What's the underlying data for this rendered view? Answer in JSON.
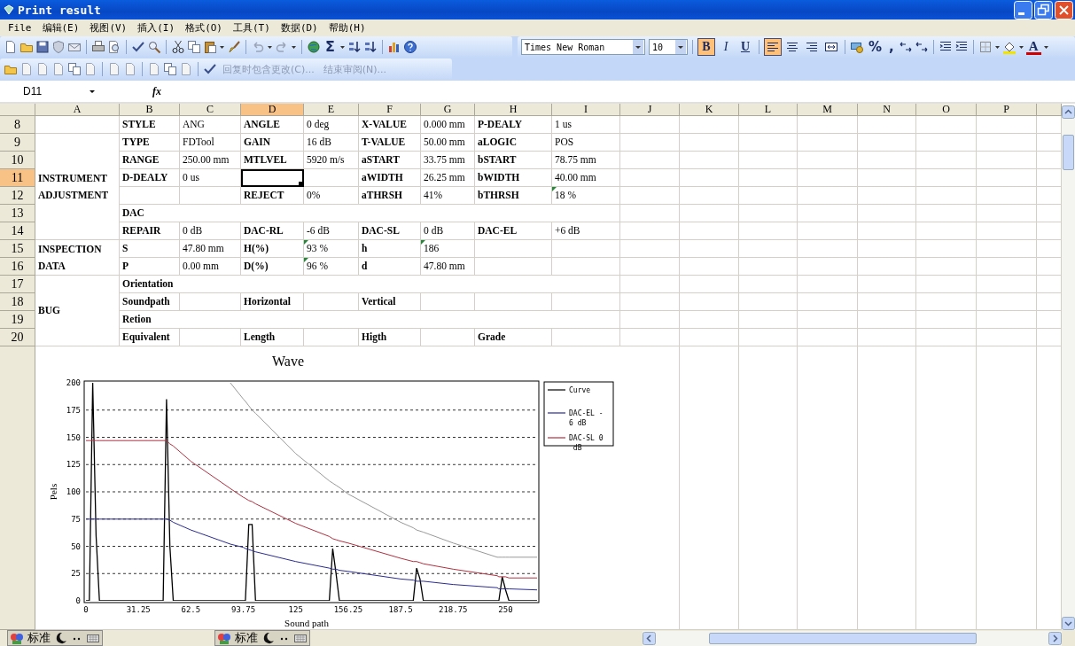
{
  "window": {
    "title": "Print result"
  },
  "menu": [
    {
      "label": "File"
    },
    {
      "label": "编辑(E)"
    },
    {
      "label": "视图(V)"
    },
    {
      "label": "插入(I)"
    },
    {
      "label": "格式(O)"
    },
    {
      "label": "工具(T)"
    },
    {
      "label": "数据(D)"
    },
    {
      "label": "帮助(H)"
    }
  ],
  "standard_toolbar": {
    "autosum_label": "Σ"
  },
  "format_toolbar": {
    "font": "Times New Roman",
    "size": "10",
    "style_buttons": [
      {
        "label": "B",
        "kind": "bold",
        "pressed": true
      },
      {
        "label": "I",
        "kind": "italic",
        "pressed": false
      },
      {
        "label": "U",
        "kind": "underline",
        "pressed": false
      }
    ],
    "align_buttons": [
      {
        "kind": "left",
        "pressed": true
      },
      {
        "kind": "center",
        "pressed": false
      },
      {
        "kind": "right",
        "pressed": false
      },
      {
        "kind": "merge",
        "pressed": false
      }
    ],
    "percent_label": "%",
    "comma_label": ",",
    "font_color_label": "A"
  },
  "reviewing_toolbar": {
    "items": [
      {
        "label": "回复时包含更改(C)...",
        "disabled": true
      },
      {
        "label": "结束审阅(N)...",
        "disabled": true
      }
    ]
  },
  "formula_bar": {
    "name_box": "D11",
    "fx_label": "fx"
  },
  "columns": [
    {
      "label": "A",
      "selected": false
    },
    {
      "label": "B",
      "selected": false
    },
    {
      "label": "C",
      "selected": false
    },
    {
      "label": "D",
      "selected": true
    },
    {
      "label": "E",
      "selected": false
    },
    {
      "label": "F",
      "selected": false
    },
    {
      "label": "G",
      "selected": false
    },
    {
      "label": "H",
      "selected": false
    },
    {
      "label": "I",
      "selected": false
    },
    {
      "label": "J",
      "selected": false
    },
    {
      "label": "K",
      "selected": false
    },
    {
      "label": "L",
      "selected": false
    },
    {
      "label": "M",
      "selected": false
    },
    {
      "label": "N",
      "selected": false
    },
    {
      "label": "O",
      "selected": false
    },
    {
      "label": "P",
      "selected": false
    }
  ],
  "rows": [
    {
      "number": "8",
      "selected": false,
      "cells": [
        {
          "kind": "blank"
        },
        {
          "kind": "text",
          "text": "STYLE",
          "bold": true,
          "flagged": false
        },
        {
          "kind": "text",
          "text": "ANG",
          "bold": false,
          "flagged": false
        },
        {
          "kind": "text",
          "text": "ANGLE",
          "bold": true,
          "flagged": false
        },
        {
          "kind": "text",
          "text": "0 deg",
          "bold": false,
          "flagged": false
        },
        {
          "kind": "text",
          "text": "X-VALUE",
          "bold": true,
          "flagged": false
        },
        {
          "kind": "text",
          "text": "0.000 mm",
          "bold": false,
          "flagged": false
        },
        {
          "kind": "text",
          "text": "P-DEALY",
          "bold": true,
          "flagged": false
        },
        {
          "kind": "text",
          "text": "1 us",
          "bold": false,
          "flagged": false
        }
      ]
    },
    {
      "number": "9",
      "selected": false,
      "cells": [
        {
          "kind": "text",
          "text": "INSTRUMENT ADJUSTMENT",
          "bold": true,
          "flagged": false
        },
        {
          "kind": "text",
          "text": "TYPE",
          "bold": true,
          "flagged": false
        },
        {
          "kind": "text",
          "text": "FDTool",
          "bold": false,
          "flagged": false
        },
        {
          "kind": "text",
          "text": "GAIN",
          "bold": true,
          "flagged": false
        },
        {
          "kind": "text",
          "text": "16 dB",
          "bold": false,
          "flagged": false
        },
        {
          "kind": "text",
          "text": "T-VALUE",
          "bold": true,
          "flagged": false
        },
        {
          "kind": "text",
          "text": "50.00 mm",
          "bold": false,
          "flagged": false
        },
        {
          "kind": "text",
          "text": "aLOGIC",
          "bold": true,
          "flagged": false
        },
        {
          "kind": "text",
          "text": "POS",
          "bold": false,
          "flagged": false
        }
      ]
    },
    {
      "number": "10",
      "selected": false,
      "cells": [
        {
          "kind": "merged-up"
        },
        {
          "kind": "text",
          "text": "RANGE",
          "bold": true,
          "flagged": false
        },
        {
          "kind": "text",
          "text": "250.00 mm",
          "bold": false,
          "flagged": false
        },
        {
          "kind": "text",
          "text": "MTLVEL",
          "bold": true,
          "flagged": false
        },
        {
          "kind": "text",
          "text": "5920 m/s",
          "bold": false,
          "flagged": false
        },
        {
          "kind": "text",
          "text": "aSTART",
          "bold": true,
          "flagged": false
        },
        {
          "kind": "text",
          "text": "33.75 mm",
          "bold": false,
          "flagged": false
        },
        {
          "kind": "text",
          "text": "bSTART",
          "bold": true,
          "flagged": false
        },
        {
          "kind": "text",
          "text": "78.75 mm",
          "bold": false,
          "flagged": false
        }
      ]
    },
    {
      "number": "11",
      "selected": true,
      "cells": [
        {
          "kind": "merged-up"
        },
        {
          "kind": "text",
          "text": "D-DEALY",
          "bold": true,
          "flagged": false
        },
        {
          "kind": "text",
          "text": "0 us",
          "bold": false,
          "flagged": false
        },
        {
          "kind": "blank"
        },
        {
          "kind": "blank"
        },
        {
          "kind": "text",
          "text": "aWIDTH",
          "bold": true,
          "flagged": false
        },
        {
          "kind": "text",
          "text": "26.25 mm",
          "bold": false,
          "flagged": false
        },
        {
          "kind": "text",
          "text": "bWIDTH",
          "bold": true,
          "flagged": false
        },
        {
          "kind": "text",
          "text": "40.00 mm",
          "bold": false,
          "flagged": false
        }
      ]
    },
    {
      "number": "12",
      "selected": false,
      "cells": [
        {
          "kind": "merged-up"
        },
        {
          "kind": "blank"
        },
        {
          "kind": "blank"
        },
        {
          "kind": "text",
          "text": "REJECT",
          "bold": true,
          "flagged": false
        },
        {
          "kind": "text",
          "text": "0%",
          "bold": false,
          "flagged": false
        },
        {
          "kind": "text",
          "text": "aTHRSH",
          "bold": true,
          "flagged": false
        },
        {
          "kind": "text",
          "text": "41%",
          "bold": false,
          "flagged": false
        },
        {
          "kind": "text",
          "text": "bTHRSH",
          "bold": true,
          "flagged": false
        },
        {
          "kind": "text",
          "text": "18 %",
          "bold": false,
          "flagged": true
        }
      ]
    },
    {
      "number": "13",
      "selected": false,
      "cells": [
        {
          "kind": "merged-up"
        },
        {
          "kind": "text",
          "text": "DAC",
          "bold": true,
          "flagged": false
        },
        {
          "kind": "merged-left"
        },
        {
          "kind": "merged-left"
        },
        {
          "kind": "merged-left"
        },
        {
          "kind": "merged-left"
        },
        {
          "kind": "merged-left"
        },
        {
          "kind": "merged-left"
        },
        {
          "kind": "merged-left"
        }
      ]
    },
    {
      "number": "14",
      "selected": false,
      "cells": [
        {
          "kind": "merged-up"
        },
        {
          "kind": "text",
          "text": "REPAIR",
          "bold": true,
          "flagged": false
        },
        {
          "kind": "text",
          "text": "0 dB",
          "bold": false,
          "flagged": false
        },
        {
          "kind": "text",
          "text": "DAC-RL",
          "bold": true,
          "flagged": false
        },
        {
          "kind": "text",
          "text": "-6 dB",
          "bold": false,
          "flagged": false
        },
        {
          "kind": "text",
          "text": "DAC-SL",
          "bold": true,
          "flagged": false
        },
        {
          "kind": "text",
          "text": "0 dB",
          "bold": false,
          "flagged": false
        },
        {
          "kind": "text",
          "text": "DAC-EL",
          "bold": true,
          "flagged": false
        },
        {
          "kind": "text",
          "text": "+6 dB",
          "bold": false,
          "flagged": false
        }
      ]
    },
    {
      "number": "15",
      "selected": false,
      "cells": [
        {
          "kind": "text",
          "text": "INSPECTION DATA",
          "bold": true,
          "flagged": false
        },
        {
          "kind": "text",
          "text": "S",
          "bold": true,
          "flagged": false
        },
        {
          "kind": "text",
          "text": "47.80 mm",
          "bold": false,
          "flagged": false
        },
        {
          "kind": "text",
          "text": "H(%)",
          "bold": true,
          "flagged": false
        },
        {
          "kind": "text",
          "text": "93 %",
          "bold": false,
          "flagged": true
        },
        {
          "kind": "text",
          "text": "h",
          "bold": true,
          "flagged": false
        },
        {
          "kind": "text",
          "text": "186",
          "bold": false,
          "flagged": true
        },
        {
          "kind": "blank"
        },
        {
          "kind": "blank"
        }
      ]
    },
    {
      "number": "16",
      "selected": false,
      "cells": [
        {
          "kind": "merged-up"
        },
        {
          "kind": "text",
          "text": "P",
          "bold": true,
          "flagged": false
        },
        {
          "kind": "text",
          "text": "0.00 mm",
          "bold": false,
          "flagged": false
        },
        {
          "kind": "text",
          "text": "D(%)",
          "bold": true,
          "flagged": false
        },
        {
          "kind": "text",
          "text": "96 %",
          "bold": false,
          "flagged": true
        },
        {
          "kind": "text",
          "text": "d",
          "bold": true,
          "flagged": false
        },
        {
          "kind": "text",
          "text": "47.80 mm",
          "bold": false,
          "flagged": false
        },
        {
          "kind": "blank"
        },
        {
          "kind": "blank"
        }
      ]
    },
    {
      "number": "17",
      "selected": false,
      "cells": [
        {
          "kind": "text",
          "text": "BUG",
          "bold": true,
          "flagged": false
        },
        {
          "kind": "text",
          "text": "Orientation",
          "bold": true,
          "flagged": false
        },
        {
          "kind": "merged-left"
        },
        {
          "kind": "merged-left"
        },
        {
          "kind": "merged-left"
        },
        {
          "kind": "merged-left"
        },
        {
          "kind": "merged-left"
        },
        {
          "kind": "merged-left"
        },
        {
          "kind": "merged-left"
        }
      ]
    },
    {
      "number": "18",
      "selected": false,
      "cells": [
        {
          "kind": "merged-up"
        },
        {
          "kind": "text",
          "text": "Soundpath",
          "bold": true,
          "flagged": false
        },
        {
          "kind": "blank"
        },
        {
          "kind": "text",
          "text": "Horizontal",
          "bold": true,
          "flagged": false
        },
        {
          "kind": "blank"
        },
        {
          "kind": "text",
          "text": "Vertical",
          "bold": true,
          "flagged": false
        },
        {
          "kind": "blank"
        },
        {
          "kind": "blank"
        },
        {
          "kind": "blank"
        }
      ]
    },
    {
      "number": "19",
      "selected": false,
      "cells": [
        {
          "kind": "merged-up"
        },
        {
          "kind": "text",
          "text": "Retion",
          "bold": true,
          "flagged": false
        },
        {
          "kind": "merged-left"
        },
        {
          "kind": "merged-left"
        },
        {
          "kind": "merged-left"
        },
        {
          "kind": "merged-left"
        },
        {
          "kind": "merged-left"
        },
        {
          "kind": "merged-left"
        },
        {
          "kind": "merged-left"
        }
      ]
    },
    {
      "number": "20",
      "selected": false,
      "cells": [
        {
          "kind": "merged-up"
        },
        {
          "kind": "text",
          "text": "Equivalent",
          "bold": true,
          "flagged": false
        },
        {
          "kind": "blank"
        },
        {
          "kind": "text",
          "text": "Length",
          "bold": true,
          "flagged": false
        },
        {
          "kind": "blank"
        },
        {
          "kind": "text",
          "text": "Higth",
          "bold": true,
          "flagged": false
        },
        {
          "kind": "blank"
        },
        {
          "kind": "text",
          "text": "Grade",
          "bold": true,
          "flagged": false
        },
        {
          "kind": "blank"
        }
      ]
    }
  ],
  "chart": {
    "chart_data": {
      "type": "line",
      "title": "Wave",
      "xlabel": "Sound path",
      "ylabel": "Pels",
      "grid": true,
      "legend": "right",
      "x": [
        0,
        2,
        4,
        6,
        8,
        46,
        48,
        50,
        52,
        62.5,
        86,
        93.75,
        95,
        97,
        99,
        101,
        125,
        145,
        147,
        149,
        151,
        156.25,
        187.5,
        195,
        197,
        199,
        201,
        218.75,
        245,
        246,
        248,
        250,
        252,
        268.75
      ],
      "xlim": [
        0,
        268.75
      ],
      "ylim": [
        0,
        200
      ],
      "xticks": [
        0,
        31.25,
        62.5,
        93.75,
        125,
        156.25,
        187.5,
        218.75,
        250
      ],
      "yticks": [
        0,
        25,
        50,
        75,
        100,
        125,
        150,
        175,
        200
      ],
      "series": [
        {
          "name": "Curve",
          "color": "#000000",
          "values": [
            0,
            0,
            200,
            60,
            0,
            0,
            185,
            50,
            0,
            0,
            0,
            0,
            0,
            70,
            70,
            0,
            0,
            0,
            48,
            25,
            0,
            0,
            0,
            0,
            30,
            20,
            0,
            0,
            0,
            0,
            22,
            10,
            0,
            0
          ]
        },
        {
          "name": "DAC-EL -6 dB",
          "color": "#2b2b8f",
          "values": [
            75,
            75,
            75,
            75,
            75,
            75,
            75,
            74,
            72,
            65,
            52,
            49,
            48,
            47,
            46,
            45,
            36,
            30,
            29,
            29,
            28,
            27,
            20,
            19,
            18,
            18,
            18,
            15,
            12,
            11,
            11,
            11,
            11,
            10
          ]
        },
        {
          "name": "DAC-SL 0 dB",
          "color": "#b03040",
          "values": [
            147,
            147,
            147,
            147,
            147,
            147,
            147,
            144,
            142,
            128,
            103,
            95,
            94,
            92,
            91,
            89,
            71,
            59,
            57,
            56,
            55,
            53,
            39,
            36,
            36,
            35,
            34,
            29,
            23,
            22,
            22,
            22,
            21,
            21
          ]
        },
        {
          "color": "#999999",
          "values": [
            null,
            null,
            null,
            null,
            null,
            null,
            null,
            null,
            null,
            null,
            200,
            185,
            183,
            179,
            175,
            172,
            135,
            110,
            108,
            106,
            104,
            98,
            72,
            67,
            65,
            64,
            63,
            53,
            40,
            40,
            40,
            40,
            40,
            40
          ]
        }
      ]
    }
  },
  "ime_bars": [
    {
      "label": "标准"
    },
    {
      "label": "标准"
    }
  ]
}
